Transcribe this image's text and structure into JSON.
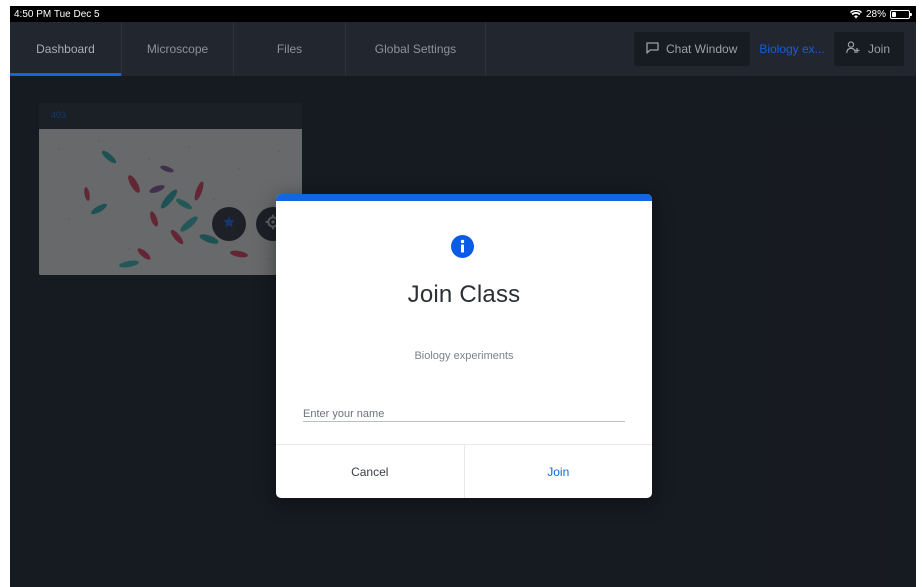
{
  "status_bar": {
    "time_date": "4:50 PM  Tue Dec 5",
    "battery_percent": "28%",
    "battery_level": 0.28,
    "icons": [
      "wifi-icon",
      "battery-icon"
    ]
  },
  "nav": {
    "tabs": [
      {
        "label": "Dashboard",
        "active": true
      },
      {
        "label": "Microscope",
        "active": false
      },
      {
        "label": "Files",
        "active": false
      },
      {
        "label": "Global Settings",
        "active": false
      }
    ],
    "chat_button": {
      "label": "Chat Window",
      "icon": "chat-icon"
    },
    "class_link": "Biology ex...",
    "join_button": {
      "label": "Join",
      "icon": "add-person-icon"
    }
  },
  "card": {
    "label": "403",
    "buttons": [
      {
        "icon": "star-icon"
      },
      {
        "icon": "gear-icon"
      }
    ]
  },
  "modal": {
    "icon": "info-icon",
    "title": "Join Class",
    "subtitle": "Biology experiments",
    "name_input": {
      "value": "",
      "placeholder": "Enter your name"
    },
    "cancel_label": "Cancel",
    "join_label": "Join"
  },
  "colors": {
    "accent": "#1565e0",
    "background": "#1c212a",
    "navbar": "#22272f"
  }
}
